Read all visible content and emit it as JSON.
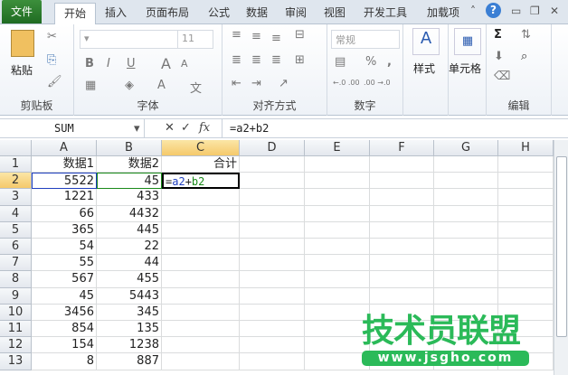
{
  "tabs": [
    "文件",
    "开始",
    "插入",
    "页面布局",
    "公式",
    "数据",
    "审阅",
    "视图",
    "开发工具",
    "加载项"
  ],
  "active_tab": "开始",
  "ribbon": {
    "clipboard": {
      "paste": "粘贴",
      "label": "剪贴板"
    },
    "font": {
      "size": "11",
      "label": "字体",
      "bold": "B",
      "italic": "I",
      "underline": "U",
      "grow": "A",
      "shrink": "A",
      "color": "A",
      "phonetic": "文"
    },
    "alignment": {
      "label": "对齐方式"
    },
    "number": {
      "format": "常规",
      "percent": "%",
      "comma": ",",
      "label": "数字",
      "inc": "←.0 .00",
      "dec": ".00 →.0"
    },
    "styles": {
      "label": "样式"
    },
    "cells": {
      "label": "单元格"
    },
    "editing": {
      "label": "编辑",
      "sum": "Σ"
    }
  },
  "formula_bar": {
    "name_box": "SUM",
    "fx": "fx",
    "cancel": "✕",
    "enter": "✓",
    "formula": "=a2+b2"
  },
  "grid": {
    "columns": [
      "A",
      "B",
      "C",
      "D",
      "E",
      "F",
      "G",
      "H"
    ],
    "selected_column": "C",
    "selected_row": "2",
    "rows": [
      [
        "数据1",
        "数据2",
        "合计"
      ],
      [
        "5522",
        "45",
        "=a2+b2"
      ],
      [
        "1221",
        "433",
        ""
      ],
      [
        "66",
        "4432",
        ""
      ],
      [
        "365",
        "445",
        ""
      ],
      [
        "54",
        "22",
        ""
      ],
      [
        "55",
        "44",
        ""
      ],
      [
        "567",
        "455",
        ""
      ],
      [
        "45",
        "5443",
        ""
      ],
      [
        "3456",
        "345",
        ""
      ],
      [
        "854",
        "135",
        ""
      ],
      [
        "154",
        "1238",
        ""
      ],
      [
        "8",
        "887",
        ""
      ]
    ],
    "formula_refs": {
      "a2": "#1f3fbf",
      "b2": "#1a8a1a"
    }
  },
  "watermark": {
    "title": "技术员联盟",
    "url": "www.jsgho.com",
    "color": "#2bba59"
  }
}
